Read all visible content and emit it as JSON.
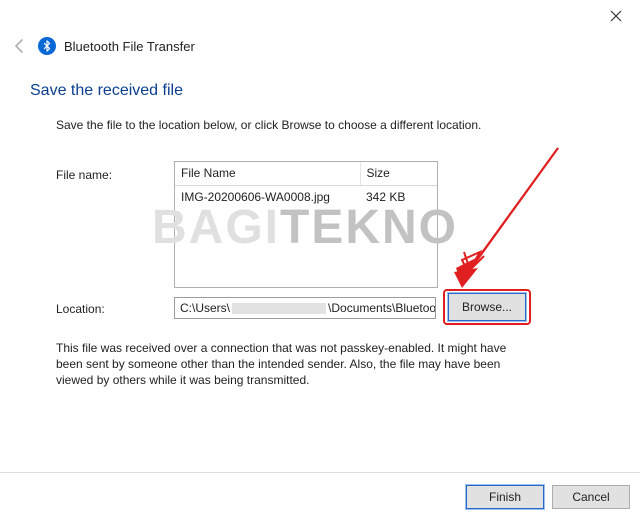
{
  "window": {
    "title": "Bluetooth File Transfer"
  },
  "heading": "Save the received file",
  "subheading": "Save the file to the location below, or click Browse to choose a different location.",
  "labels": {
    "file_name": "File name:",
    "location": "Location:"
  },
  "file_table": {
    "col_name": "File Name",
    "col_size": "Size",
    "rows": [
      {
        "name": "IMG-20200606-WA0008.jpg",
        "size": "342 KB"
      }
    ]
  },
  "location": {
    "prefix": "C:\\Users\\",
    "suffix": "\\Documents\\Bluetooth"
  },
  "buttons": {
    "browse": "Browse...",
    "finish": "Finish",
    "cancel": "Cancel"
  },
  "warning": "This file was received over a connection that was not passkey-enabled. It might have been sent by someone other than the intended sender. Also, the file may have been viewed by others while it was being transmitted.",
  "watermark": {
    "part1": "BAGI",
    "part2": "TEKNO"
  }
}
